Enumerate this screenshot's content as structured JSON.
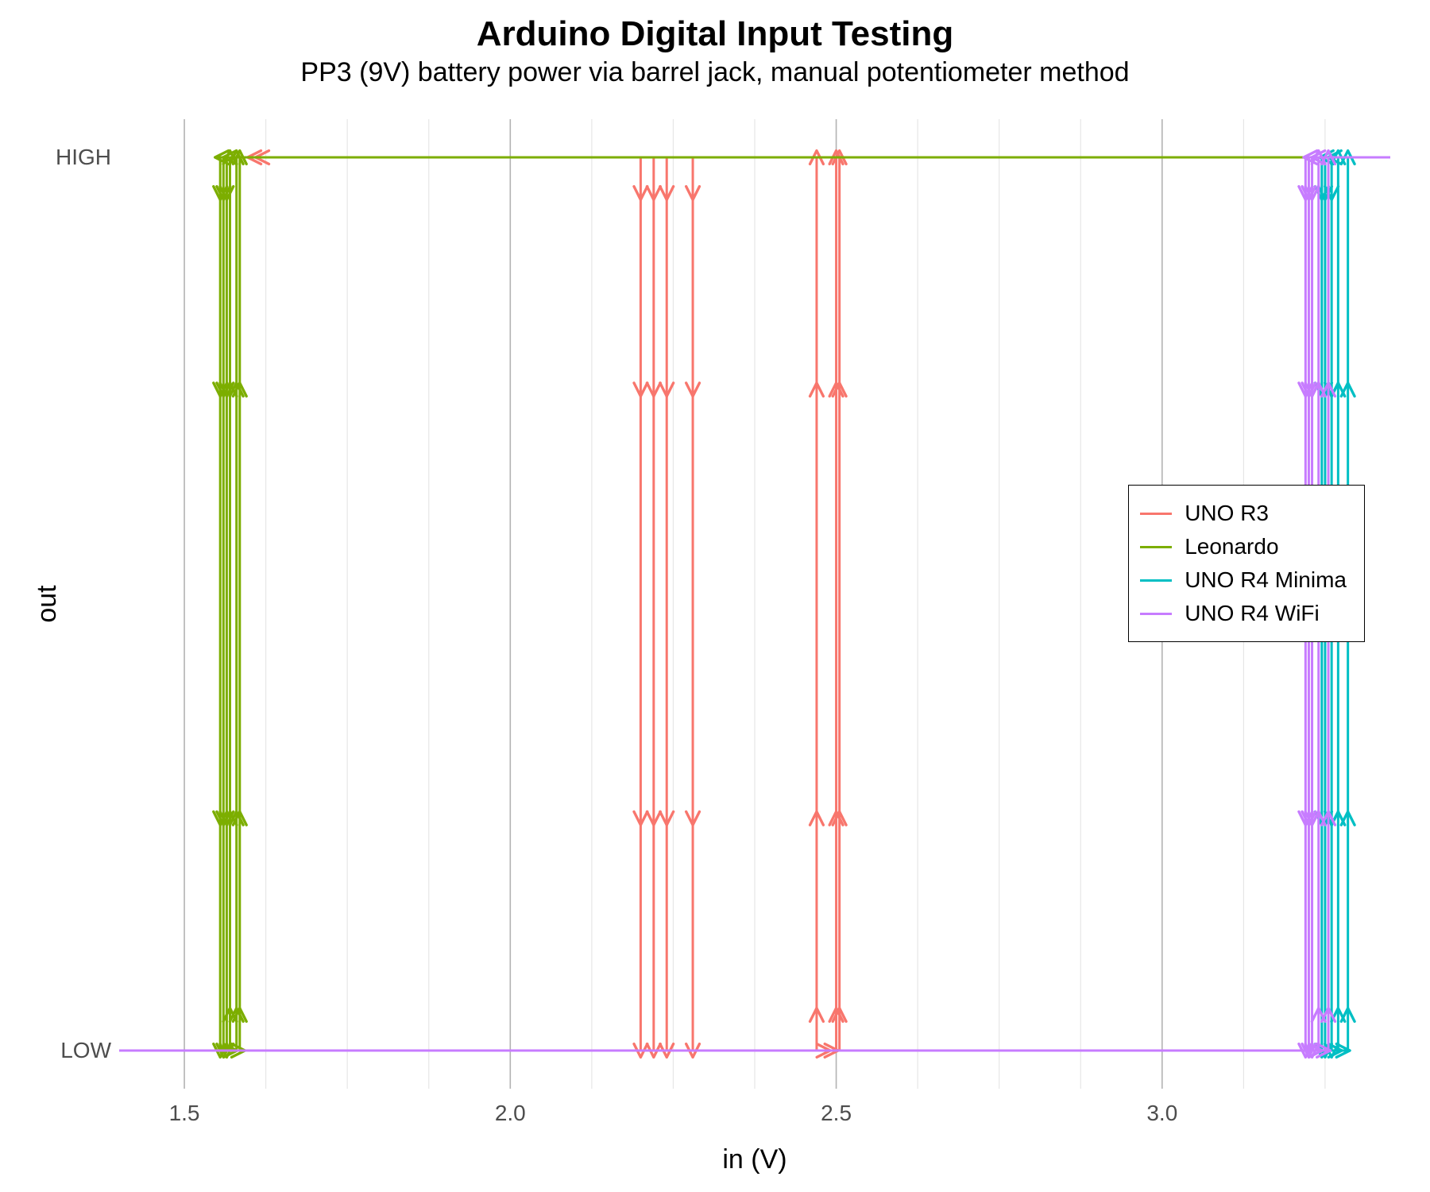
{
  "chart_data": {
    "type": "line",
    "title": "Arduino Digital Input Testing",
    "subtitle": "PP3 (9V) battery power via barrel jack, manual potentiometer method",
    "xlabel": "in (V)",
    "ylabel": "out",
    "xlim": [
      1.4,
      3.35
    ],
    "x_ticks_major": [
      1.5,
      2.0,
      2.5,
      3.0
    ],
    "x_ticks_minor": [
      1.5,
      1.625,
      1.75,
      1.875,
      2.0,
      2.125,
      2.25,
      2.375,
      2.5,
      2.625,
      2.75,
      2.875,
      3.0,
      3.125,
      3.25
    ],
    "y_categories": [
      "LOW",
      "HIGH"
    ],
    "y_positions": {
      "LOW": 0,
      "HIGH": 1
    },
    "legend_position": "right-middle",
    "series": [
      {
        "name": "UNO R3",
        "color": "#F8766D",
        "thresholds_up": [
          2.47,
          2.5,
          2.5
        ],
        "thresholds_down": [
          2.2,
          2.22,
          2.24,
          2.28
        ],
        "segments": [
          {
            "type": "horiz",
            "y": "LOW",
            "x1": 1.4,
            "x2": 2.5,
            "dir": "right"
          },
          {
            "type": "vert",
            "x": 2.47,
            "y1": "LOW",
            "y2": "HIGH",
            "dir": "up"
          },
          {
            "type": "vert",
            "x": 2.5,
            "y1": "LOW",
            "y2": "HIGH",
            "dir": "up"
          },
          {
            "type": "vert",
            "x": 2.505,
            "y1": "LOW",
            "y2": "HIGH",
            "dir": "up"
          },
          {
            "type": "horiz",
            "y": "HIGH",
            "x1": 1.6,
            "x2": 3.35,
            "dir": "left"
          },
          {
            "type": "vert",
            "x": 2.2,
            "y1": "HIGH",
            "y2": "LOW",
            "dir": "down"
          },
          {
            "type": "vert",
            "x": 2.22,
            "y1": "HIGH",
            "y2": "LOW",
            "dir": "down"
          },
          {
            "type": "vert",
            "x": 2.24,
            "y1": "HIGH",
            "y2": "LOW",
            "dir": "down"
          },
          {
            "type": "vert",
            "x": 2.28,
            "y1": "HIGH",
            "y2": "LOW",
            "dir": "down"
          }
        ]
      },
      {
        "name": "Leonardo",
        "color": "#7CAE00",
        "thresholds_up": [
          1.57,
          1.58,
          1.585
        ],
        "thresholds_down": [
          1.555,
          1.56,
          1.565
        ],
        "segments": [
          {
            "type": "horiz",
            "y": "LOW",
            "x1": 1.4,
            "x2": 1.59,
            "dir": "right"
          },
          {
            "type": "vert",
            "x": 1.57,
            "y1": "LOW",
            "y2": "HIGH",
            "dir": "up"
          },
          {
            "type": "vert",
            "x": 1.58,
            "y1": "LOW",
            "y2": "HIGH",
            "dir": "up"
          },
          {
            "type": "vert",
            "x": 1.585,
            "y1": "LOW",
            "y2": "HIGH",
            "dir": "up"
          },
          {
            "type": "horiz",
            "y": "HIGH",
            "x1": 1.55,
            "x2": 3.35,
            "dir": "left"
          },
          {
            "type": "vert",
            "x": 1.555,
            "y1": "HIGH",
            "y2": "LOW",
            "dir": "down"
          },
          {
            "type": "vert",
            "x": 1.56,
            "y1": "HIGH",
            "y2": "LOW",
            "dir": "down"
          },
          {
            "type": "vert",
            "x": 1.565,
            "y1": "HIGH",
            "y2": "LOW",
            "dir": "down"
          }
        ]
      },
      {
        "name": "UNO R4 Minima",
        "color": "#00BFC4",
        "thresholds_up": [
          3.27,
          3.285
        ],
        "thresholds_down": [
          3.245,
          3.25,
          3.26
        ],
        "segments": [
          {
            "type": "horiz",
            "y": "LOW",
            "x1": 1.4,
            "x2": 3.285,
            "dir": "right"
          },
          {
            "type": "vert",
            "x": 3.27,
            "y1": "LOW",
            "y2": "HIGH",
            "dir": "up"
          },
          {
            "type": "vert",
            "x": 3.285,
            "y1": "LOW",
            "y2": "HIGH",
            "dir": "up"
          },
          {
            "type": "horiz",
            "y": "HIGH",
            "x1": 3.245,
            "x2": 3.35,
            "dir": "left"
          },
          {
            "type": "vert",
            "x": 3.245,
            "y1": "HIGH",
            "y2": "LOW",
            "dir": "down"
          },
          {
            "type": "vert",
            "x": 3.25,
            "y1": "HIGH",
            "y2": "LOW",
            "dir": "down"
          },
          {
            "type": "vert",
            "x": 3.26,
            "y1": "HIGH",
            "y2": "LOW",
            "dir": "down"
          }
        ]
      },
      {
        "name": "UNO R4 WiFi",
        "color": "#C77CFF",
        "thresholds_up": [
          3.24,
          3.255
        ],
        "thresholds_down": [
          3.22,
          3.225,
          3.23
        ],
        "segments": [
          {
            "type": "horiz",
            "y": "LOW",
            "x1": 1.4,
            "x2": 3.255,
            "dir": "right"
          },
          {
            "type": "vert",
            "x": 3.24,
            "y1": "LOW",
            "y2": "HIGH",
            "dir": "up"
          },
          {
            "type": "vert",
            "x": 3.255,
            "y1": "LOW",
            "y2": "HIGH",
            "dir": "up"
          },
          {
            "type": "horiz",
            "y": "HIGH",
            "x1": 3.22,
            "x2": 3.35,
            "dir": "left"
          },
          {
            "type": "vert",
            "x": 3.22,
            "y1": "HIGH",
            "y2": "LOW",
            "dir": "down"
          },
          {
            "type": "vert",
            "x": 3.225,
            "y1": "HIGH",
            "y2": "LOW",
            "dir": "down"
          },
          {
            "type": "vert",
            "x": 3.23,
            "y1": "HIGH",
            "y2": "LOW",
            "dir": "down"
          }
        ]
      }
    ]
  }
}
